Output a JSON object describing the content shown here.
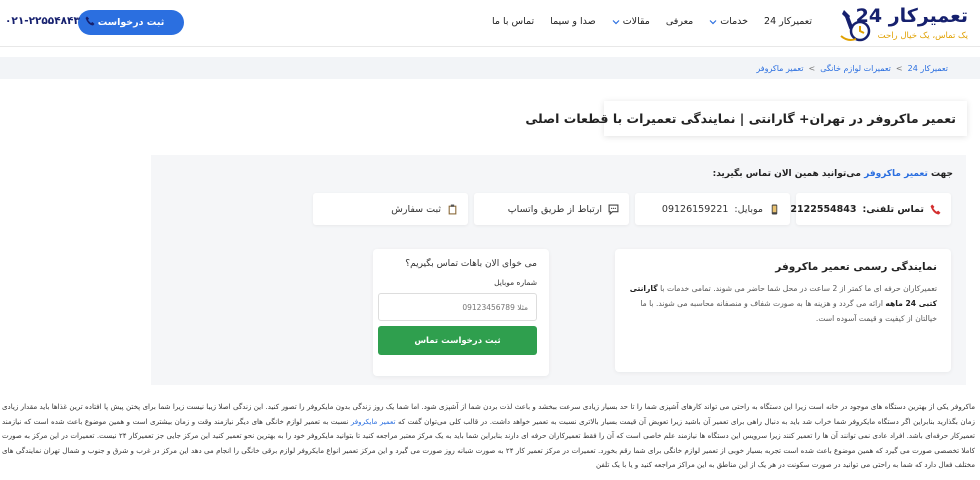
{
  "header": {
    "logo_title": "تعمیرکار 24",
    "logo_tagline": "یک تماس، یک خیال راحت",
    "nav": [
      {
        "label": "تعمیرکار 24",
        "dropdown": false
      },
      {
        "label": "خدمات",
        "dropdown": true
      },
      {
        "label": "معرفی",
        "dropdown": false
      },
      {
        "label": "مقالات",
        "dropdown": true
      },
      {
        "label": "صدا و سیما",
        "dropdown": false
      },
      {
        "label": "تماس با ما",
        "dropdown": false
      }
    ],
    "cta_label": "ثبت درخواست",
    "phone": "۰۲۱-۲۲۵۵۴۸۴۳"
  },
  "breadcrumb": {
    "home": "تعمیرکار 24",
    "category": "تعمیرات لوازم خانگی",
    "current": "تعمیر ماکروفر",
    "separator": ">"
  },
  "page_title": "تعمیر ماکروفر در تهران+ گارانتی | نمایندگی تعمیرات با قطعات اصلی",
  "call_line": {
    "prefix": "جهت",
    "highlight": "تعمیر ماکروفر",
    "suffix": "می‌توانید همین الان تماس بگیرید:"
  },
  "contact_cards": {
    "phone_label": "تماس تلفنی:",
    "phone_value": "02122554843",
    "mobile_label": "موبایل:",
    "mobile_value": "09126159221",
    "whatsapp_label": "ارتباط از طریق واتساپ",
    "order_label": "ثبت سفارش"
  },
  "info": {
    "title": "نمایندگی رسمی تعمیر ماکروفر",
    "text_1": "تعمیرکاران حرفه ای ما کمتر از 2 ساعت در محل شما حاضر می شوند. تمامی خدمات با",
    "guarantee": "گارانتی کتبی 24 ماهه",
    "text_2": "ارائه می گردد و هزینه ها به صورت شفاف و منصفانه محاسبه می شوند. با ما خیالتان از کیفیت و قیمت آسوده است."
  },
  "form": {
    "question": "می خوای الان باهات تماس بگیریم؟",
    "field_label": "شماره موبایل",
    "placeholder": "مثلا 09123456789",
    "submit_label": "ثبت درخواست تماس"
  },
  "body": {
    "part_1": "ماکروفر یکی از بهترین دستگاه های موجود در خانه است زیرا این دستگاه به راحتی می تواند کارهای آشپزی شما را تا حد بسیار زیادی سرعت ببخشد و باعث لذت بردن شما از آشپزی شود. اما شما یک روز زندگی بدون مایکروفر را تصور کنید. این زندگی اصلا زیبا نیست زیرا شما برای پختن پیش پا افتاده ترین غذاها باید مقدار زیادی زمان بگذارید بنابراین اگر دستگاه مایکروفر شما خراب شد باید به دنبال راهی برای تعمیر آن باشید زیرا تعویض آن قیمت بسیار بالاتری نسبت به تعمیر خواهد داشت. در قالب کلی می‌توان گفت که",
    "link": "تعمیر مایکروفر",
    "part_2": "نسبت به تعمیر لوازم خانگی های دیگر نیازمند وقت و زمان بیشتری است و همین موضوع باعث شده است که نیازمند تعمیرکار حرفه‌ای باشد. افراد عادی نمی توانند آن ها را تعمیر کنند زیرا سرویس این دستگاه ها نیازمند علم خاصی است که آن را فقط تعمیرکاران حرفه ای دارند بنابراین شما باید به یک مرکز معتبر مراجعه کنید تا بتوانید مایکروفر خود را به بهترین نحو تعمیر کنید این مرکز جایی جز تعمیرکار ۲۴ نیست. تعمیرات در این مرکز به صورت کاملا تخصصی صورت می گیرد که همین موضوع باعث شده است تجربه بسیار خوبی از تعمیر لوازم خانگی برای شما رقم بخورد. تعمیرات در مرکز تعمیر کار ۲۴ به صورت شبانه روز صورت می گیرد و این مرکز تعمیر انواع مایکروفر لوازم برقی خانگی را انجام می دهد این مرکز در غرب و شرق و جنوب و شمال تهران نمایندگی های مختلف فعال دارد که شما به راحتی می توانید در صورت سکونت در هر یک از این مناطق به این مراکز مراجعه کنید و یا با یک تلفن"
  },
  "colors": {
    "brand_navy": "#16206e",
    "accent_blue": "#2b6fe0",
    "green_button": "#2f9f4e",
    "phone_icon_red": "#d32f2f"
  }
}
